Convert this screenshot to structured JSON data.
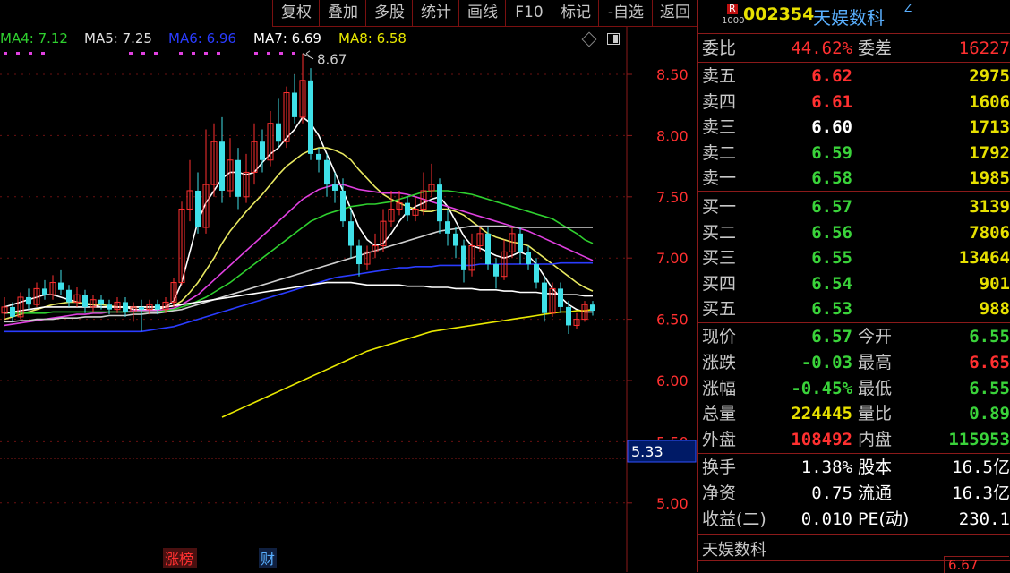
{
  "toolbar": {
    "items": [
      "复权",
      "叠加",
      "多股",
      "统计",
      "画线",
      "F10",
      "标记",
      "-自选",
      "返回"
    ]
  },
  "ma_legend": [
    {
      "label": "MA4: 7.12",
      "color": "#2fd02f"
    },
    {
      "label": "MA5: 7.25",
      "color": "#e0e0e0"
    },
    {
      "label": "MA6: 6.96",
      "color": "#2a3cff"
    },
    {
      "label": "MA7: 6.69",
      "color": "#ffffff"
    },
    {
      "label": "MA8: 6.58",
      "color": "#e8e800"
    }
  ],
  "chart_data": {
    "type": "candlestick",
    "ylim": [
      4.8,
      8.75
    ],
    "y_ticks": [
      "8.50",
      "8.00",
      "7.50",
      "7.00",
      "6.50",
      "6.00",
      "5.50",
      "5.00"
    ],
    "high_marker": "8.67",
    "cursor_price": "5.33",
    "bottom_tags": [
      "涨榜",
      "财"
    ],
    "bottom_right_value": "6.67",
    "candles": [
      [
        6.55,
        6.6,
        6.68,
        6.5
      ],
      [
        6.6,
        6.52,
        6.64,
        6.48
      ],
      [
        6.52,
        6.68,
        6.72,
        6.5
      ],
      [
        6.68,
        6.62,
        6.75,
        6.58
      ],
      [
        6.62,
        6.75,
        6.8,
        6.6
      ],
      [
        6.75,
        6.7,
        6.82,
        6.66
      ],
      [
        6.7,
        6.8,
        6.86,
        6.66
      ],
      [
        6.8,
        6.74,
        6.9,
        6.7
      ],
      [
        6.74,
        6.64,
        6.78,
        6.6
      ],
      [
        6.64,
        6.7,
        6.76,
        6.6
      ],
      [
        6.7,
        6.6,
        6.74,
        6.55
      ],
      [
        6.6,
        6.66,
        6.7,
        6.56
      ],
      [
        6.66,
        6.62,
        6.7,
        6.58
      ],
      [
        6.62,
        6.58,
        6.66,
        6.54
      ],
      [
        6.58,
        6.64,
        6.68,
        6.55
      ],
      [
        6.64,
        6.56,
        6.68,
        6.52
      ],
      [
        6.56,
        6.6,
        6.64,
        6.48
      ],
      [
        6.6,
        6.58,
        6.66,
        6.4
      ],
      [
        6.58,
        6.62,
        6.66,
        6.54
      ],
      [
        6.62,
        6.58,
        6.66,
        6.54
      ],
      [
        6.58,
        6.64,
        6.68,
        6.55
      ],
      [
        6.64,
        6.8,
        6.84,
        6.6
      ],
      [
        6.8,
        7.4,
        7.46,
        6.78
      ],
      [
        7.4,
        7.55,
        7.8,
        7.3
      ],
      [
        7.55,
        7.25,
        7.7,
        7.2
      ],
      [
        7.25,
        7.6,
        8.05,
        7.2
      ],
      [
        7.6,
        7.95,
        8.1,
        7.5
      ],
      [
        7.95,
        7.55,
        8.15,
        7.45
      ],
      [
        7.55,
        7.8,
        7.98,
        7.5
      ],
      [
        7.8,
        7.5,
        7.9,
        7.4
      ],
      [
        7.5,
        7.7,
        7.85,
        7.45
      ],
      [
        7.7,
        7.95,
        8.1,
        7.6
      ],
      [
        7.95,
        7.8,
        8.05,
        7.7
      ],
      [
        7.8,
        8.1,
        8.2,
        7.75
      ],
      [
        8.1,
        7.95,
        8.3,
        7.9
      ],
      [
        7.95,
        8.35,
        8.4,
        7.9
      ],
      [
        8.35,
        8.15,
        8.5,
        8.1
      ],
      [
        8.15,
        8.45,
        8.67,
        8.1
      ],
      [
        8.45,
        7.85,
        8.55,
        7.8
      ],
      [
        7.85,
        7.8,
        7.9,
        7.7
      ],
      [
        7.8,
        7.6,
        7.85,
        7.5
      ],
      [
        7.6,
        7.55,
        7.7,
        7.45
      ],
      [
        7.55,
        7.3,
        7.65,
        7.25
      ],
      [
        7.3,
        7.1,
        7.4,
        7.0
      ],
      [
        7.1,
        6.95,
        7.15,
        6.85
      ],
      [
        6.95,
        7.05,
        7.1,
        6.9
      ],
      [
        7.05,
        7.1,
        7.2,
        7.0
      ],
      [
        7.1,
        7.3,
        7.4,
        7.05
      ],
      [
        7.3,
        7.4,
        7.55,
        7.25
      ],
      [
        7.4,
        7.45,
        7.55,
        7.35
      ],
      [
        7.45,
        7.35,
        7.5,
        7.3
      ],
      [
        7.35,
        7.4,
        7.5,
        7.3
      ],
      [
        7.4,
        7.55,
        7.7,
        7.35
      ],
      [
        7.55,
        7.6,
        7.77,
        7.5
      ],
      [
        7.6,
        7.3,
        7.65,
        7.2
      ],
      [
        7.3,
        7.2,
        7.4,
        7.1
      ],
      [
        7.2,
        7.1,
        7.25,
        7.0
      ],
      [
        7.1,
        6.9,
        7.15,
        6.8
      ],
      [
        6.9,
        7.1,
        7.2,
        6.85
      ],
      [
        7.1,
        7.2,
        7.25,
        7.05
      ],
      [
        7.2,
        6.95,
        7.25,
        6.9
      ],
      [
        6.95,
        6.85,
        7.0,
        6.75
      ],
      [
        6.85,
        7.05,
        7.15,
        6.82
      ],
      [
        7.05,
        7.2,
        7.25,
        7.0
      ],
      [
        7.2,
        7.05,
        7.25,
        6.95
      ],
      [
        7.05,
        6.95,
        7.1,
        6.9
      ],
      [
        6.95,
        6.8,
        7.0,
        6.75
      ],
      [
        6.8,
        6.55,
        6.85,
        6.48
      ],
      [
        6.55,
        6.75,
        6.8,
        6.52
      ],
      [
        6.75,
        6.6,
        6.8,
        6.55
      ],
      [
        6.6,
        6.45,
        6.65,
        6.38
      ],
      [
        6.45,
        6.5,
        6.55,
        6.42
      ],
      [
        6.5,
        6.62,
        6.65,
        6.48
      ],
      [
        6.62,
        6.57,
        6.65,
        6.53
      ]
    ],
    "ma_lines": [
      {
        "name": "MA1",
        "color": "#ffffff",
        "values": [
          6.6,
          6.62,
          6.64,
          6.66,
          6.68,
          6.7,
          6.7,
          6.68,
          6.66,
          6.64,
          6.62,
          6.62,
          6.6,
          6.6,
          6.6,
          6.6,
          6.58,
          6.58,
          6.58,
          6.58,
          6.6,
          6.65,
          6.8,
          7.05,
          7.3,
          7.45,
          7.55,
          7.65,
          7.7,
          7.7,
          7.68,
          7.7,
          7.78,
          7.85,
          7.9,
          7.98,
          8.05,
          8.15,
          8.1,
          8.0,
          7.85,
          7.7,
          7.55,
          7.4,
          7.25,
          7.15,
          7.1,
          7.12,
          7.2,
          7.3,
          7.38,
          7.42,
          7.45,
          7.48,
          7.5,
          7.42,
          7.3,
          7.18,
          7.1,
          7.08,
          7.05,
          7.02,
          7.0,
          7.02,
          7.05,
          7.02,
          6.95,
          6.85,
          6.75,
          6.68,
          6.62,
          6.58,
          6.56,
          6.56
        ]
      },
      {
        "name": "MA2",
        "color": "#e8e860",
        "values": [
          6.5,
          6.52,
          6.54,
          6.56,
          6.58,
          6.6,
          6.62,
          6.63,
          6.64,
          6.64,
          6.63,
          6.62,
          6.62,
          6.61,
          6.6,
          6.6,
          6.6,
          6.6,
          6.6,
          6.6,
          6.6,
          6.61,
          6.65,
          6.72,
          6.8,
          6.9,
          7.0,
          7.12,
          7.22,
          7.3,
          7.38,
          7.45,
          7.52,
          7.6,
          7.68,
          7.75,
          7.8,
          7.85,
          7.88,
          7.9,
          7.9,
          7.88,
          7.85,
          7.8,
          7.72,
          7.65,
          7.58,
          7.52,
          7.48,
          7.45,
          7.42,
          7.4,
          7.38,
          7.38,
          7.4,
          7.4,
          7.38,
          7.35,
          7.3,
          7.25,
          7.2,
          7.17,
          7.15,
          7.13,
          7.12,
          7.1,
          7.05,
          7.0,
          6.95,
          6.9,
          6.85,
          6.8,
          6.76,
          6.73
        ]
      },
      {
        "name": "MA3",
        "color": "#e040e0",
        "values": [
          6.45,
          6.46,
          6.47,
          6.48,
          6.49,
          6.5,
          6.51,
          6.52,
          6.53,
          6.54,
          6.54,
          6.55,
          6.55,
          6.56,
          6.56,
          6.56,
          6.57,
          6.57,
          6.57,
          6.57,
          6.58,
          6.59,
          6.62,
          6.66,
          6.7,
          6.76,
          6.82,
          6.88,
          6.94,
          7.0,
          7.06,
          7.12,
          7.18,
          7.24,
          7.3,
          7.36,
          7.42,
          7.48,
          7.52,
          7.56,
          7.58,
          7.6,
          7.6,
          7.58,
          7.56,
          7.55,
          7.54,
          7.53,
          7.53,
          7.53,
          7.52,
          7.5,
          7.48,
          7.46,
          7.44,
          7.42,
          7.4,
          7.38,
          7.36,
          7.34,
          7.32,
          7.3,
          7.28,
          7.26,
          7.24,
          7.22,
          7.19,
          7.16,
          7.13,
          7.1,
          7.07,
          7.04,
          7.01,
          6.98
        ]
      },
      {
        "name": "MA4",
        "color": "#2fd02f",
        "values": [
          6.55,
          6.55,
          6.55,
          6.55,
          6.55,
          6.55,
          6.56,
          6.56,
          6.56,
          6.56,
          6.56,
          6.56,
          6.56,
          6.56,
          6.56,
          6.56,
          6.56,
          6.56,
          6.56,
          6.56,
          6.57,
          6.58,
          6.6,
          6.62,
          6.65,
          6.68,
          6.72,
          6.76,
          6.8,
          6.85,
          6.9,
          6.95,
          7.0,
          7.05,
          7.1,
          7.15,
          7.2,
          7.25,
          7.3,
          7.33,
          7.36,
          7.38,
          7.4,
          7.42,
          7.43,
          7.44,
          7.44,
          7.45,
          7.46,
          7.48,
          7.5,
          7.52,
          7.54,
          7.55,
          7.55,
          7.55,
          7.54,
          7.53,
          7.52,
          7.5,
          7.48,
          7.46,
          7.44,
          7.42,
          7.4,
          7.38,
          7.36,
          7.34,
          7.32,
          7.28,
          7.24,
          7.2,
          7.15,
          7.12
        ]
      },
      {
        "name": "MA5",
        "color": "#cfcfcf",
        "values": [
          6.48,
          6.48,
          6.49,
          6.49,
          6.5,
          6.5,
          6.5,
          6.51,
          6.51,
          6.51,
          6.52,
          6.52,
          6.52,
          6.53,
          6.53,
          6.53,
          6.54,
          6.54,
          6.55,
          6.55,
          6.56,
          6.57,
          6.58,
          6.6,
          6.62,
          6.64,
          6.66,
          6.68,
          6.7,
          6.72,
          6.74,
          6.76,
          6.78,
          6.8,
          6.82,
          6.84,
          6.86,
          6.88,
          6.9,
          6.92,
          6.94,
          6.96,
          6.98,
          7.0,
          7.02,
          7.04,
          7.06,
          7.08,
          7.1,
          7.12,
          7.14,
          7.16,
          7.18,
          7.2,
          7.22,
          7.23,
          7.24,
          7.25,
          7.26,
          7.26,
          7.26,
          7.26,
          7.26,
          7.25,
          7.25,
          7.25,
          7.25,
          7.25,
          7.25,
          7.25,
          7.25,
          7.25,
          7.25,
          7.25
        ]
      },
      {
        "name": "MA6",
        "color": "#2a3cff",
        "values": [
          6.4,
          6.4,
          6.4,
          6.4,
          6.4,
          6.4,
          6.4,
          6.4,
          6.4,
          6.4,
          6.4,
          6.4,
          6.4,
          6.4,
          6.4,
          6.4,
          6.4,
          6.4,
          6.41,
          6.42,
          6.43,
          6.44,
          6.46,
          6.48,
          6.5,
          6.52,
          6.54,
          6.56,
          6.58,
          6.6,
          6.62,
          6.64,
          6.66,
          6.68,
          6.7,
          6.72,
          6.74,
          6.76,
          6.78,
          6.8,
          6.82,
          6.84,
          6.85,
          6.86,
          6.87,
          6.88,
          6.89,
          6.9,
          6.91,
          6.92,
          6.92,
          6.93,
          6.93,
          6.93,
          6.94,
          6.94,
          6.94,
          6.94,
          6.94,
          6.95,
          6.95,
          6.95,
          6.95,
          6.95,
          6.95,
          6.95,
          6.95,
          6.95,
          6.95,
          6.96,
          6.96,
          6.96,
          6.96,
          6.96
        ]
      },
      {
        "name": "MA7",
        "color": "#ffffff",
        "values": [
          6.55,
          6.56,
          6.57,
          6.58,
          6.59,
          6.6,
          6.6,
          6.6,
          6.6,
          6.6,
          6.6,
          6.6,
          6.6,
          6.6,
          6.6,
          6.6,
          6.6,
          6.6,
          6.6,
          6.6,
          6.6,
          6.61,
          6.62,
          6.63,
          6.64,
          6.65,
          6.66,
          6.67,
          6.68,
          6.69,
          6.7,
          6.71,
          6.72,
          6.73,
          6.74,
          6.75,
          6.76,
          6.77,
          6.78,
          6.79,
          6.8,
          6.8,
          6.8,
          6.8,
          6.79,
          6.78,
          6.78,
          6.78,
          6.78,
          6.78,
          6.77,
          6.77,
          6.77,
          6.76,
          6.76,
          6.76,
          6.75,
          6.75,
          6.75,
          6.74,
          6.74,
          6.74,
          6.73,
          6.73,
          6.72,
          6.72,
          6.72,
          6.71,
          6.71,
          6.7,
          6.7,
          6.7,
          6.69,
          6.69
        ]
      },
      {
        "name": "MA8",
        "color": "#e8e800",
        "values": [
          null,
          null,
          null,
          null,
          null,
          null,
          null,
          null,
          null,
          null,
          null,
          null,
          null,
          null,
          null,
          null,
          null,
          null,
          null,
          null,
          null,
          null,
          null,
          null,
          null,
          null,
          null,
          5.7,
          5.73,
          5.76,
          5.79,
          5.82,
          5.85,
          5.88,
          5.91,
          5.94,
          5.97,
          6.0,
          6.03,
          6.06,
          6.09,
          6.12,
          6.15,
          6.18,
          6.21,
          6.24,
          6.26,
          6.28,
          6.3,
          6.32,
          6.34,
          6.36,
          6.38,
          6.4,
          6.41,
          6.42,
          6.43,
          6.44,
          6.45,
          6.46,
          6.47,
          6.48,
          6.49,
          6.5,
          6.51,
          6.52,
          6.53,
          6.54,
          6.55,
          6.56,
          6.56,
          6.57,
          6.57,
          6.58
        ]
      }
    ]
  },
  "quote": {
    "badge_top": "R",
    "badge_bottom": "1000",
    "code": "002354",
    "name": "天娱数科",
    "mark": "Z",
    "weibi_label": "委比",
    "weibi_value": "44.62%",
    "weicha_label": "委差",
    "weicha_value": "16227",
    "sell": [
      {
        "label": "卖五",
        "price": "6.62",
        "vol": "2975",
        "price_color": "red"
      },
      {
        "label": "卖四",
        "price": "6.61",
        "vol": "1606",
        "price_color": "red"
      },
      {
        "label": "卖三",
        "price": "6.60",
        "vol": "1713",
        "price_color": "white"
      },
      {
        "label": "卖二",
        "price": "6.59",
        "vol": "1792",
        "price_color": "green"
      },
      {
        "label": "卖一",
        "price": "6.58",
        "vol": "1985",
        "price_color": "green"
      }
    ],
    "buy": [
      {
        "label": "买一",
        "price": "6.57",
        "vol": "3139",
        "price_color": "green"
      },
      {
        "label": "买二",
        "price": "6.56",
        "vol": "7806",
        "price_color": "green"
      },
      {
        "label": "买三",
        "price": "6.55",
        "vol": "13464",
        "price_color": "green"
      },
      {
        "label": "买四",
        "price": "6.54",
        "vol": "901",
        "price_color": "green"
      },
      {
        "label": "买五",
        "price": "6.53",
        "vol": "988",
        "price_color": "green"
      }
    ],
    "stats1": [
      {
        "l1": "现价",
        "v1": "6.57",
        "c1": "green",
        "l2": "今开",
        "v2": "6.55",
        "c2": "green"
      },
      {
        "l1": "涨跌",
        "v1": "-0.03",
        "c1": "green",
        "l2": "最高",
        "v2": "6.65",
        "c2": "red"
      },
      {
        "l1": "涨幅",
        "v1": "-0.45%",
        "c1": "green",
        "l2": "最低",
        "v2": "6.55",
        "c2": "green"
      },
      {
        "l1": "总量",
        "v1": "224445",
        "c1": "yellow",
        "l2": "量比",
        "v2": "0.89",
        "c2": "green"
      },
      {
        "l1": "外盘",
        "v1": "108492",
        "c1": "red",
        "l2": "内盘",
        "v2": "115953",
        "c2": "green"
      }
    ],
    "stats2": [
      {
        "l1": "换手",
        "v1": "1.38%",
        "l2": "股本",
        "v2": "16.5亿"
      },
      {
        "l1": "净资",
        "v1": "0.75",
        "l2": "流通",
        "v2": "16.3亿"
      },
      {
        "l1": "收益(二)",
        "v1": "0.010",
        "l2": "PE(动)",
        "v2": "230.1"
      }
    ],
    "footer_name": "天娱数科"
  }
}
